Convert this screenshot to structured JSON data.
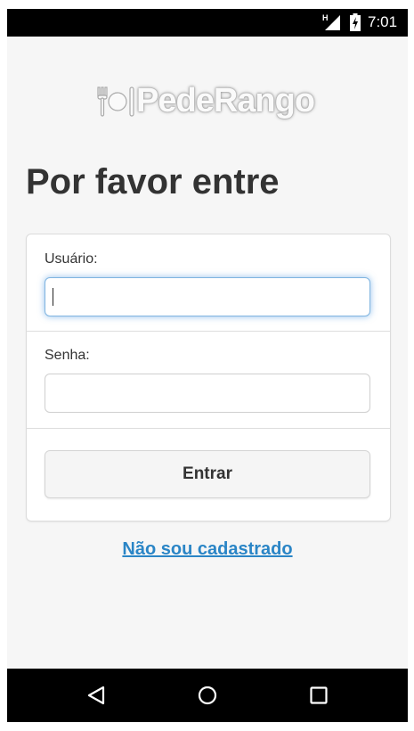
{
  "status_bar": {
    "network_label": "H",
    "time": "7:01",
    "icons": [
      "signal-icon",
      "battery-icon"
    ]
  },
  "logo": {
    "text": "PedeRango",
    "icon": "fork-plate-icon"
  },
  "page": {
    "title": "Por favor entre"
  },
  "form": {
    "user_label": "Usuário:",
    "user_value": "",
    "password_label": "Senha:",
    "password_value": "",
    "submit_label": "Entrar"
  },
  "register_link": "Não sou cadastrado",
  "nav_bar": {
    "icons": [
      "back-icon",
      "home-icon",
      "recents-icon"
    ]
  },
  "colors": {
    "background": "#f6f6f6",
    "link": "#2a85c6",
    "focus_glow": "#7fb4e0",
    "text": "#333333"
  }
}
